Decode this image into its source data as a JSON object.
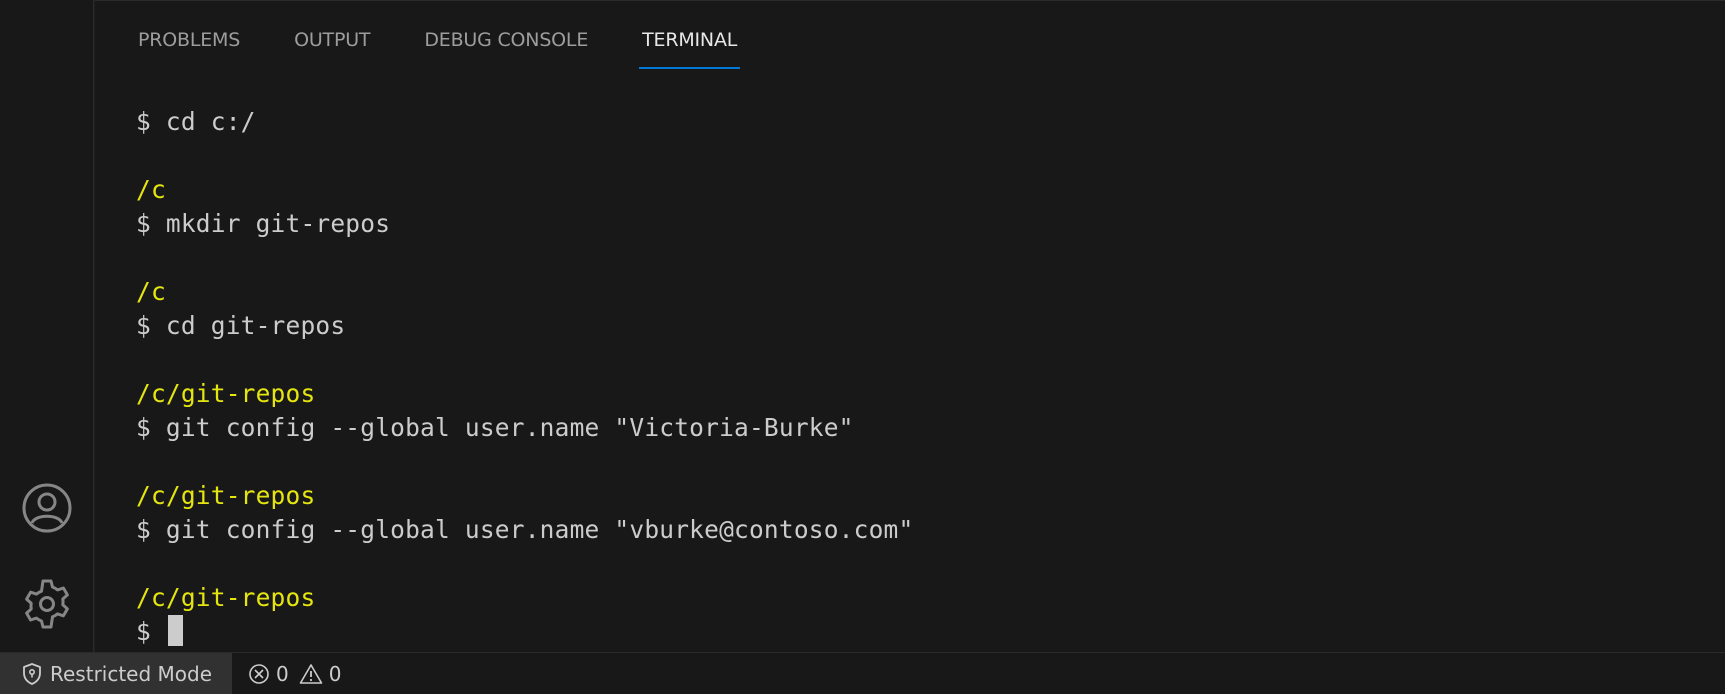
{
  "panel": {
    "tabs": [
      {
        "label": "PROBLEMS"
      },
      {
        "label": "OUTPUT"
      },
      {
        "label": "DEBUG CONSOLE"
      },
      {
        "label": "TERMINAL",
        "active": true
      }
    ]
  },
  "terminal": {
    "lines": [
      {
        "kind": "command",
        "prompt": "$",
        "text": "cd c:/"
      },
      {
        "kind": "cwd",
        "text": "/c"
      },
      {
        "kind": "command",
        "prompt": "$",
        "text": "mkdir git-repos"
      },
      {
        "kind": "cwd",
        "text": "/c"
      },
      {
        "kind": "command",
        "prompt": "$",
        "text": "cd git-repos"
      },
      {
        "kind": "cwd",
        "text": "/c/git-repos"
      },
      {
        "kind": "command",
        "prompt": "$",
        "text": "git config --global user.name \"Victoria-Burke\""
      },
      {
        "kind": "cwd",
        "text": "/c/git-repos"
      },
      {
        "kind": "command",
        "prompt": "$",
        "text": "git config --global user.name \"vburke@contoso.com\""
      },
      {
        "kind": "cwd",
        "text": "/c/git-repos"
      },
      {
        "kind": "input",
        "prompt": "$",
        "text": ""
      }
    ],
    "colors": {
      "cwd": "#e5e510",
      "text": "#cccccc",
      "cursor": "#cccccc"
    }
  },
  "activity_bar": {
    "icons": [
      "account-icon",
      "gear-icon"
    ]
  },
  "statusbar": {
    "restricted_label": "Restricted Mode",
    "errors": "0",
    "warnings": "0"
  },
  "colors": {
    "accent": "#0078d4",
    "background": "#181818"
  }
}
